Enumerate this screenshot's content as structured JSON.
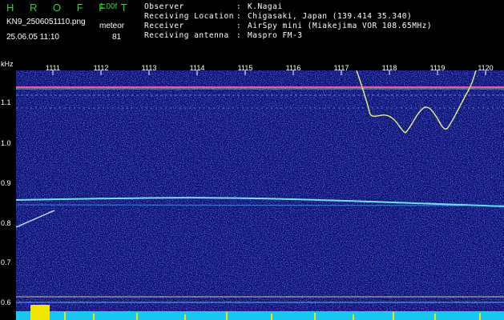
{
  "header": {
    "app_name": "H R O F F T",
    "version": "1.00f",
    "filename": "KN9_2506051110.png",
    "meteor_label": "meteor",
    "datetime": "25.06.05 11:10",
    "meteor_count": "81"
  },
  "info": [
    {
      "key": "Observer",
      "value": "K.Nagai"
    },
    {
      "key": "Receiving Location",
      "value": "Chigasaki, Japan (139.414 35.340)"
    },
    {
      "key": "Receiver",
      "value": "AirSpy mini (Miakejima VOR 108.65MHz)"
    },
    {
      "key": "Receiving antenna",
      "value": "Maspro FM-3"
    }
  ],
  "chart_data": {
    "type": "heatmap",
    "ylabel": "kHz",
    "y_ticks": [
      "1.1",
      "1.0",
      "0.9",
      "0.8",
      "0.7",
      "0.6"
    ],
    "x_ticks": [
      "1111",
      "1112",
      "1113",
      "1114",
      "1115",
      "1116",
      "1117",
      "1118",
      "1119",
      "1120"
    ],
    "ylim": [
      0.58,
      1.16
    ],
    "colors": {
      "background": "#0a0a6e",
      "noise": "#3a5fd0",
      "signal": "#6ff0ff",
      "carrier": "#ff4fb0"
    }
  }
}
